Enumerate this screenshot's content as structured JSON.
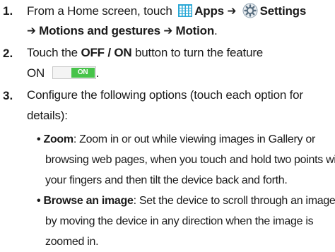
{
  "steps": [
    {
      "number": "1.",
      "text_a": "From a Home screen, touch",
      "apps_label": "Apps",
      "arrow1": "➔",
      "settings_label": "Settings",
      "arrow2": "➔",
      "path_a": "Motions and gestures",
      "arrow3": "➔",
      "path_b": "Motion",
      "end": "."
    },
    {
      "number": "2.",
      "text_a": "Touch the",
      "button_name": "OFF / ON",
      "text_b": "button to turn the feature",
      "text_c": "ON",
      "toggle_label": "ON",
      "end": "."
    },
    {
      "number": "3.",
      "line1": "Configure the following options (touch each option for",
      "line2": "details):"
    }
  ],
  "options": [
    {
      "bullet": "•",
      "name": "Zoom",
      "desc_first": ": Zoom in or out while viewing images in Gallery or",
      "desc_more": [
        "browsing web pages, when you touch and hold two points with",
        "your fingers and then tilt the device back and forth."
      ]
    },
    {
      "bullet": "•",
      "name": "Browse an image",
      "desc_first": ": Set the device to scroll through an image",
      "desc_more": [
        "by moving the device in any direction when the image is",
        "zoomed in."
      ]
    }
  ],
  "colors": {
    "toggle_on": "#47c34a",
    "apps_icon": "#2aa8d6",
    "settings_icon": "#5a6f80"
  }
}
